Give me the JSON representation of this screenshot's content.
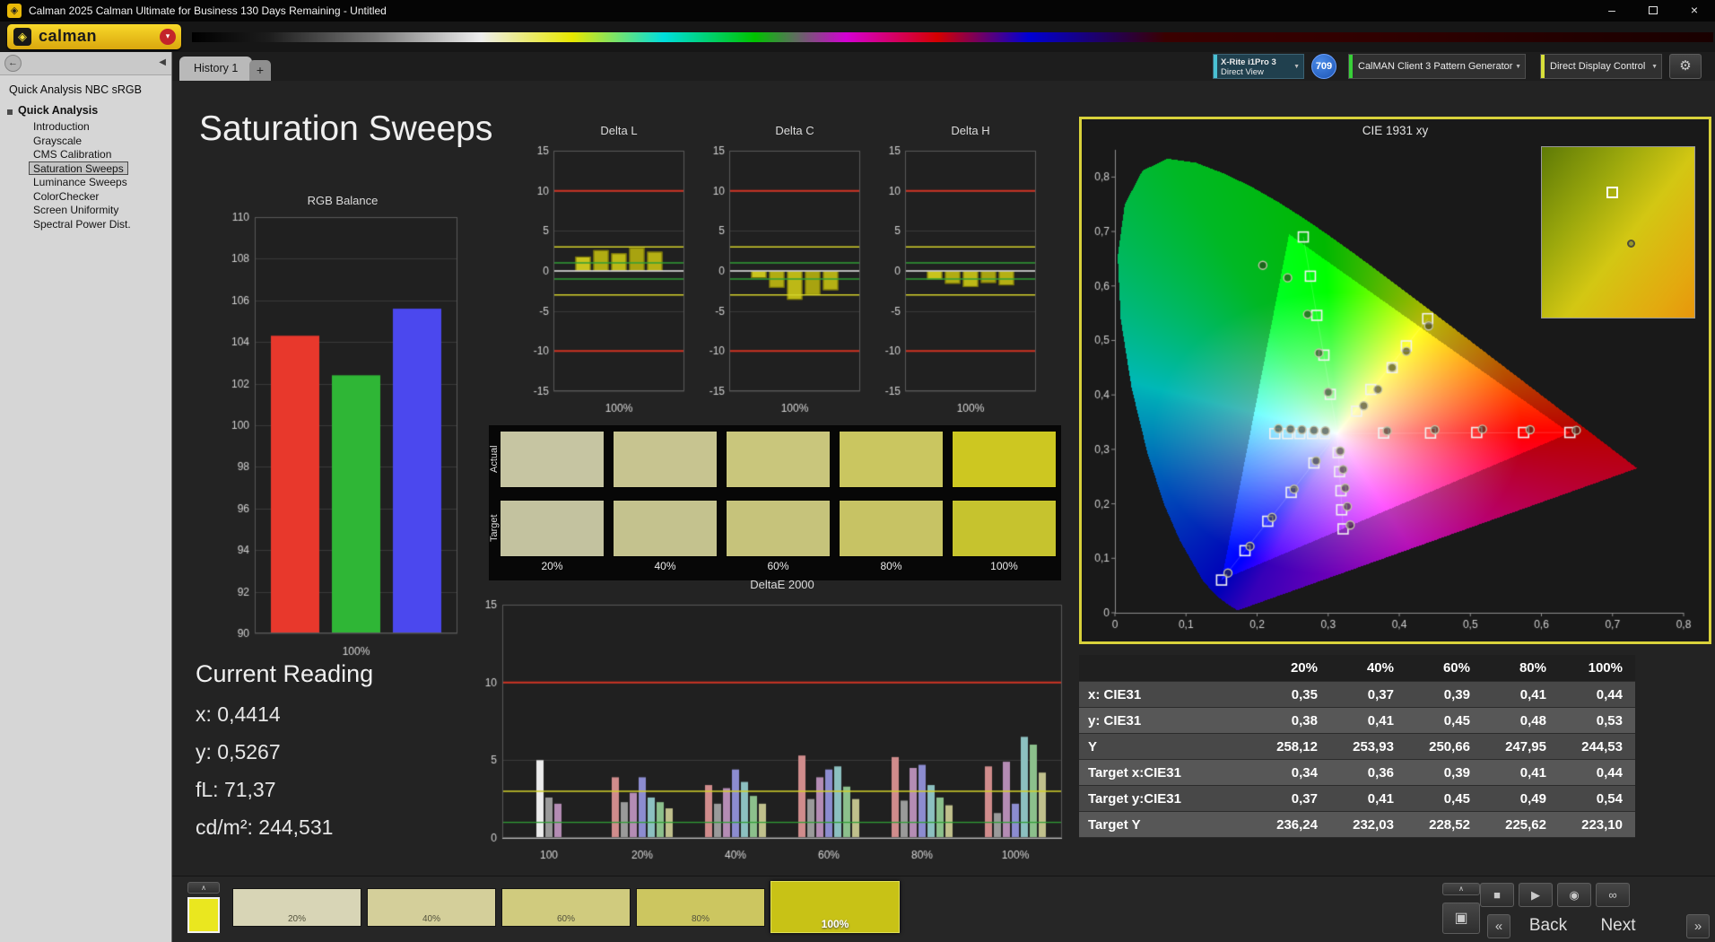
{
  "window": {
    "title": "Calman 2025 Calman Ultimate for Business 130 Days Remaining  - Untitled"
  },
  "icons": {
    "app_logo": "◈",
    "logo_mark": "◈",
    "logo_dropdown": "▾",
    "minimize": "–",
    "close": "×",
    "nav_back": "←",
    "collapse": "◀",
    "chip_dropdown": "▼",
    "gear": "⚙",
    "chevron_up": "∧",
    "stop": "■",
    "play": "▶",
    "capture": "◉",
    "link": "∞",
    "frame": "▣",
    "prev_chevron": "«",
    "next_chevron": "»"
  },
  "toolbar": {
    "logo_text": "calman"
  },
  "tabs": {
    "history": "History 1",
    "add": "+"
  },
  "devices": {
    "meter": {
      "line1": "X-Rite i1Pro 3",
      "line2": "Direct View",
      "accent": "#49c1d4"
    },
    "badge": {
      "text": "709"
    },
    "pattern_generator": {
      "label": "CalMAN Client 3 Pattern Generator",
      "accent": "#38d038"
    },
    "display_control": {
      "label": "Direct Display Control",
      "accent": "#d8e03a"
    }
  },
  "sidebar": {
    "header": "Quick Analysis NBC sRGB",
    "root": "Quick Analysis",
    "items": [
      "Introduction",
      "Grayscale",
      "CMS Calibration",
      "Saturation Sweeps",
      "Luminance Sweeps",
      "ColorChecker",
      "Screen Uniformity",
      "Spectral Power Dist."
    ],
    "selected_index": 3
  },
  "page": {
    "title": "Saturation Sweeps"
  },
  "current_reading": {
    "title": "Current Reading",
    "lines": [
      "x: 0,4414",
      "y: 0,5267",
      "fL: 71,37",
      "cd/m²: 244,531"
    ]
  },
  "swatch_panel": {
    "row_labels": [
      "Actual",
      "Target"
    ],
    "column_labels": [
      "20%",
      "40%",
      "60%",
      "80%",
      "100%"
    ],
    "actual_colors": [
      "#c6c5a2",
      "#c7c490",
      "#c9c67c",
      "#cac660",
      "#cdc721"
    ],
    "target_colors": [
      "#c3c29f",
      "#c4c28e",
      "#c6c37b",
      "#c7c364",
      "#c6c32e"
    ]
  },
  "table": {
    "header": [
      "",
      "20%",
      "40%",
      "60%",
      "80%",
      "100%"
    ],
    "rows": [
      {
        "label": "x: CIE31",
        "values": [
          "0,35",
          "0,37",
          "0,39",
          "0,41",
          "0,44"
        ]
      },
      {
        "label": "y: CIE31",
        "values": [
          "0,38",
          "0,41",
          "0,45",
          "0,48",
          "0,53"
        ]
      },
      {
        "label": "Y",
        "values": [
          "258,12",
          "253,93",
          "250,66",
          "247,95",
          "244,53"
        ]
      },
      {
        "label": "Target x:CIE31",
        "values": [
          "0,34",
          "0,36",
          "0,39",
          "0,41",
          "0,44"
        ]
      },
      {
        "label": "Target y:CIE31",
        "values": [
          "0,37",
          "0,41",
          "0,45",
          "0,49",
          "0,54"
        ]
      },
      {
        "label": "Target Y",
        "values": [
          "236,24",
          "232,03",
          "228,52",
          "225,62",
          "223,10"
        ]
      }
    ]
  },
  "bottom": {
    "patterns": [
      {
        "label": "20%",
        "color": "#d8d5b6"
      },
      {
        "label": "40%",
        "color": "#d4cf9a"
      },
      {
        "label": "60%",
        "color": "#d0cb7e"
      },
      {
        "label": "80%",
        "color": "#ccc660"
      },
      {
        "label": "100%",
        "color": "#c8c216"
      }
    ],
    "selected_index": 4,
    "current_color": "#eae71f",
    "back_label": "Back",
    "next_label": "Next"
  },
  "chart_data": [
    {
      "id": "rgb_balance",
      "type": "bar",
      "title": "RGB Balance",
      "categories": [
        "Red",
        "Green",
        "Blue"
      ],
      "values": [
        104.3,
        102.4,
        105.6
      ],
      "colors": [
        "#e8382c",
        "#2fb636",
        "#4b48ee"
      ],
      "ylim": [
        90,
        110
      ],
      "ytick": 2,
      "xlabel": "100%"
    },
    {
      "id": "delta_l",
      "type": "bar",
      "title": "Delta L",
      "categories": [
        "20%",
        "40%",
        "60%",
        "80%",
        "100%"
      ],
      "values": [
        1.8,
        2.6,
        2.2,
        2.9,
        2.4
      ],
      "ylim": [
        -15,
        15
      ],
      "ytick": 5,
      "xlabel": "100%",
      "ref_lines": {
        "red": [
          10,
          -10
        ],
        "yellow": [
          3,
          -3
        ],
        "green": [
          1,
          -1
        ]
      }
    },
    {
      "id": "delta_c",
      "type": "bar",
      "title": "Delta C",
      "categories": [
        "20%",
        "40%",
        "60%",
        "80%",
        "100%"
      ],
      "values": [
        -0.9,
        -2.1,
        -3.6,
        -3.0,
        -2.4
      ],
      "ylim": [
        -15,
        15
      ],
      "ytick": 5,
      "xlabel": "100%",
      "ref_lines": {
        "red": [
          10,
          -10
        ],
        "yellow": [
          3,
          -3
        ],
        "green": [
          1,
          -1
        ]
      }
    },
    {
      "id": "delta_h",
      "type": "bar",
      "title": "Delta H",
      "categories": [
        "20%",
        "40%",
        "60%",
        "80%",
        "100%"
      ],
      "values": [
        -1.1,
        -1.6,
        -2.0,
        -1.5,
        -1.8
      ],
      "ylim": [
        -15,
        15
      ],
      "ytick": 5,
      "xlabel": "100%",
      "ref_lines": {
        "red": [
          10,
          -10
        ],
        "yellow": [
          3,
          -3
        ],
        "green": [
          1,
          -1
        ]
      }
    },
    {
      "id": "deltae_2000",
      "type": "bar",
      "title": "DeltaE 2000",
      "categories": [
        "100",
        "20%",
        "40%",
        "60%",
        "80%",
        "100%"
      ],
      "palette": [
        "#ececec",
        "#d08c8c",
        "#b48cb4",
        "#8c8cd0",
        "#8cc0c0",
        "#8cc08c",
        "#c0c08c",
        "#9a9a9a"
      ],
      "groups": [
        [
          [
            0,
            5.0
          ],
          [
            7,
            2.6
          ],
          [
            2,
            2.2
          ]
        ],
        [
          [
            1,
            3.9
          ],
          [
            7,
            2.3
          ],
          [
            2,
            2.9
          ],
          [
            3,
            3.9
          ],
          [
            4,
            2.6
          ],
          [
            5,
            2.3
          ],
          [
            6,
            1.9
          ]
        ],
        [
          [
            1,
            3.4
          ],
          [
            7,
            2.2
          ],
          [
            2,
            3.2
          ],
          [
            3,
            4.4
          ],
          [
            4,
            3.6
          ],
          [
            5,
            2.7
          ],
          [
            6,
            2.2
          ]
        ],
        [
          [
            1,
            5.3
          ],
          [
            7,
            2.5
          ],
          [
            2,
            3.9
          ],
          [
            3,
            4.4
          ],
          [
            4,
            4.6
          ],
          [
            5,
            3.3
          ],
          [
            6,
            2.5
          ]
        ],
        [
          [
            1,
            5.2
          ],
          [
            7,
            2.4
          ],
          [
            2,
            4.5
          ],
          [
            3,
            4.7
          ],
          [
            4,
            3.4
          ],
          [
            5,
            2.6
          ],
          [
            6,
            2.1
          ]
        ],
        [
          [
            1,
            4.6
          ],
          [
            7,
            1.6
          ],
          [
            2,
            4.9
          ],
          [
            3,
            2.2
          ],
          [
            4,
            6.5
          ],
          [
            5,
            6.0
          ],
          [
            6,
            4.2
          ]
        ]
      ],
      "ylim": [
        0,
        15
      ],
      "ytick": 5,
      "ref_lines": {
        "red": [
          10
        ],
        "yellow": [
          3
        ],
        "green": [
          1
        ]
      }
    },
    {
      "id": "cie_1931",
      "type": "scatter",
      "title": "CIE 1931 xy",
      "xlim": [
        0,
        0.8
      ],
      "ylim": [
        0,
        0.85
      ],
      "xtick_labels": [
        "0",
        "0,1",
        "0,2",
        "0,3",
        "0,4",
        "0,5",
        "0,6",
        "0,7",
        "0,8"
      ],
      "ytick_labels": [
        "0",
        "0,1",
        "0,2",
        "0,3",
        "0,4",
        "0,5",
        "0,6",
        "0,7",
        "0,8"
      ],
      "white_point": [
        0.3127,
        0.329
      ],
      "gamut_triangle": [
        [
          0.64,
          0.33
        ],
        [
          0.245,
          0.695
        ],
        [
          0.15,
          0.06
        ]
      ],
      "targets": [
        [
          0.378,
          0.33
        ],
        [
          0.444,
          0.33
        ],
        [
          0.509,
          0.331
        ],
        [
          0.575,
          0.331
        ],
        [
          0.64,
          0.331
        ],
        [
          0.295,
          0.329
        ],
        [
          0.278,
          0.329
        ],
        [
          0.26,
          0.329
        ],
        [
          0.243,
          0.329
        ],
        [
          0.225,
          0.329
        ],
        [
          0.303,
          0.401
        ],
        [
          0.294,
          0.473
        ],
        [
          0.284,
          0.546
        ],
        [
          0.275,
          0.618
        ],
        [
          0.265,
          0.69
        ],
        [
          0.28,
          0.275
        ],
        [
          0.248,
          0.221
        ],
        [
          0.215,
          0.168
        ],
        [
          0.183,
          0.114
        ],
        [
          0.15,
          0.06
        ],
        [
          0.314,
          0.294
        ],
        [
          0.316,
          0.259
        ],
        [
          0.318,
          0.224
        ],
        [
          0.319,
          0.189
        ],
        [
          0.321,
          0.154
        ],
        [
          0.34,
          0.37
        ],
        [
          0.36,
          0.41
        ],
        [
          0.39,
          0.45
        ],
        [
          0.41,
          0.49
        ],
        [
          0.44,
          0.54
        ]
      ],
      "measurements": [
        [
          0.383,
          0.334
        ],
        [
          0.45,
          0.336
        ],
        [
          0.517,
          0.337
        ],
        [
          0.584,
          0.336
        ],
        [
          0.649,
          0.335
        ],
        [
          0.296,
          0.334
        ],
        [
          0.28,
          0.335
        ],
        [
          0.263,
          0.336
        ],
        [
          0.247,
          0.337
        ],
        [
          0.23,
          0.338
        ],
        [
          0.3,
          0.405
        ],
        [
          0.287,
          0.477
        ],
        [
          0.271,
          0.548
        ],
        [
          0.243,
          0.615
        ],
        [
          0.208,
          0.638
        ],
        [
          0.283,
          0.279
        ],
        [
          0.252,
          0.227
        ],
        [
          0.221,
          0.175
        ],
        [
          0.19,
          0.122
        ],
        [
          0.159,
          0.073
        ],
        [
          0.317,
          0.297
        ],
        [
          0.321,
          0.263
        ],
        [
          0.324,
          0.229
        ],
        [
          0.327,
          0.195
        ],
        [
          0.331,
          0.161
        ],
        [
          0.35,
          0.38
        ],
        [
          0.37,
          0.41
        ],
        [
          0.39,
          0.45
        ],
        [
          0.41,
          0.48
        ],
        [
          0.4414,
          0.5267
        ]
      ]
    }
  ]
}
